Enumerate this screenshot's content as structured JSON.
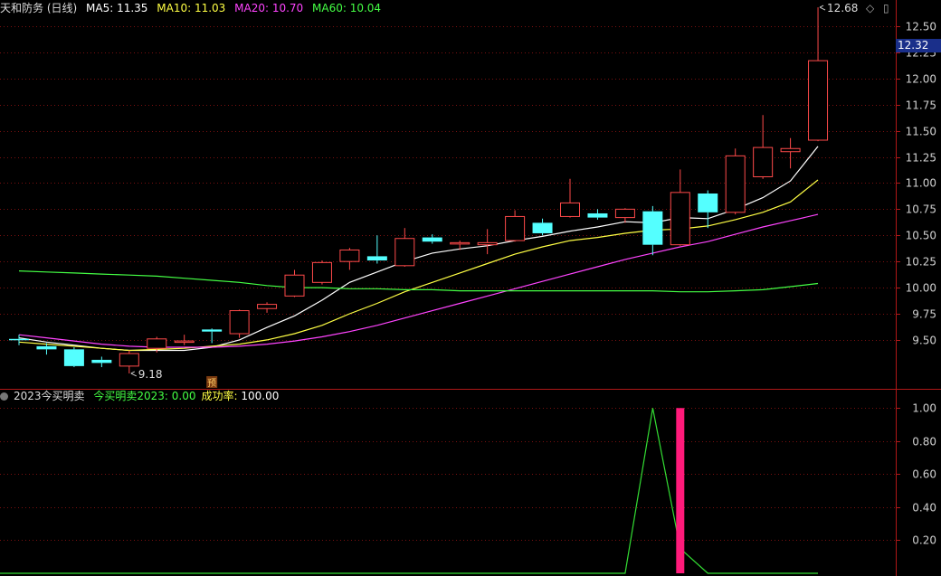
{
  "header": {
    "title": "天和防务 (日线)",
    "ma_items": [
      {
        "label": "MA5: 11.35",
        "color": "#ffffff"
      },
      {
        "label": "MA10: 11.03",
        "color": "#ffff44"
      },
      {
        "label": "MA20: 10.70",
        "color": "#ff44ff"
      },
      {
        "label": "MA60: 10.04",
        "color": "#44ff44"
      }
    ]
  },
  "current_price": "12.32",
  "marker_label": "预",
  "indicator": {
    "name": "2023今买明卖",
    "items": [
      {
        "label": "今买明卖2023: 0.00",
        "color": "#44ff44"
      },
      {
        "label": "成功率: ",
        "color": "#ffff44"
      },
      {
        "label": "100.00",
        "color": "#ffffff"
      }
    ]
  },
  "colors": {
    "up": "#ff4a4a",
    "down": "#54ffff",
    "axis": "#b01818",
    "grid": "#7a1010",
    "tick": "#d0d0d0",
    "signal_bar": "#ff1a7a"
  },
  "chart_data": [
    {
      "type": "candlestick",
      "ylim": [
        9.05,
        12.75
      ],
      "yticks": [
        9.5,
        9.75,
        10.0,
        10.25,
        10.5,
        10.75,
        11.0,
        11.25,
        11.5,
        11.75,
        12.0,
        12.25,
        12.5
      ],
      "ytick_labels": [
        "9.50",
        "9.75",
        "10.00",
        "10.25",
        "10.50",
        "10.75",
        "11.00",
        "11.25",
        "11.50",
        "11.75",
        "12.00",
        "12.25",
        "12.50"
      ],
      "annotations": [
        {
          "label": "12.68",
          "candle_index": 29,
          "value": 12.68
        },
        {
          "label": "9.18",
          "candle_index": 4,
          "value": 9.18
        }
      ],
      "candles": [
        {
          "o": 9.51,
          "h": 9.55,
          "l": 9.45,
          "c": 9.5
        },
        {
          "o": 9.44,
          "h": 9.47,
          "l": 9.36,
          "c": 9.41
        },
        {
          "o": 9.41,
          "h": 9.43,
          "l": 9.24,
          "c": 9.25
        },
        {
          "o": 9.31,
          "h": 9.34,
          "l": 9.24,
          "c": 9.28
        },
        {
          "o": 9.25,
          "h": 9.4,
          "l": 9.18,
          "c": 9.37
        },
        {
          "o": 9.42,
          "h": 9.53,
          "l": 9.38,
          "c": 9.51
        },
        {
          "o": 9.48,
          "h": 9.55,
          "l": 9.45,
          "c": 9.49
        },
        {
          "o": 9.6,
          "h": 9.61,
          "l": 9.47,
          "c": 9.58
        },
        {
          "o": 9.56,
          "h": 9.79,
          "l": 9.52,
          "c": 9.78
        },
        {
          "o": 9.8,
          "h": 9.86,
          "l": 9.76,
          "c": 9.84
        },
        {
          "o": 9.92,
          "h": 10.17,
          "l": 9.91,
          "c": 10.12
        },
        {
          "o": 10.05,
          "h": 10.26,
          "l": 10.03,
          "c": 10.24
        },
        {
          "o": 10.25,
          "h": 10.38,
          "l": 10.17,
          "c": 10.36
        },
        {
          "o": 10.3,
          "h": 10.5,
          "l": 10.23,
          "c": 10.26
        },
        {
          "o": 10.21,
          "h": 10.57,
          "l": 10.2,
          "c": 10.47
        },
        {
          "o": 10.48,
          "h": 10.51,
          "l": 10.42,
          "c": 10.44
        },
        {
          "o": 10.42,
          "h": 10.45,
          "l": 10.36,
          "c": 10.43
        },
        {
          "o": 10.41,
          "h": 10.56,
          "l": 10.32,
          "c": 10.43
        },
        {
          "o": 10.45,
          "h": 10.74,
          "l": 10.44,
          "c": 10.68
        },
        {
          "o": 10.62,
          "h": 10.66,
          "l": 10.5,
          "c": 10.52
        },
        {
          "o": 10.68,
          "h": 11.04,
          "l": 10.67,
          "c": 10.81
        },
        {
          "o": 10.71,
          "h": 10.75,
          "l": 10.65,
          "c": 10.67
        },
        {
          "o": 10.67,
          "h": 10.76,
          "l": 10.62,
          "c": 10.75
        },
        {
          "o": 10.73,
          "h": 10.78,
          "l": 10.31,
          "c": 10.41
        },
        {
          "o": 10.41,
          "h": 11.13,
          "l": 10.4,
          "c": 10.91
        },
        {
          "o": 10.9,
          "h": 10.93,
          "l": 10.57,
          "c": 10.72
        },
        {
          "o": 10.72,
          "h": 11.33,
          "l": 10.7,
          "c": 11.26
        },
        {
          "o": 11.06,
          "h": 11.65,
          "l": 11.04,
          "c": 11.34
        },
        {
          "o": 11.3,
          "h": 11.43,
          "l": 11.14,
          "c": 11.33
        },
        {
          "o": 11.41,
          "h": 12.68,
          "l": 11.4,
          "c": 12.17
        }
      ],
      "ma": [
        {
          "name": "MA5",
          "color": "#ffffff",
          "values": [
            9.52,
            9.48,
            9.45,
            9.42,
            9.4,
            9.4,
            9.4,
            9.43,
            9.5,
            9.62,
            9.73,
            9.88,
            10.05,
            10.15,
            10.25,
            10.33,
            10.37,
            10.4,
            10.45,
            10.49,
            10.54,
            10.58,
            10.63,
            10.62,
            10.67,
            10.66,
            10.75,
            10.86,
            11.02,
            11.35
          ]
        },
        {
          "name": "MA10",
          "color": "#ffff44",
          "values": [
            9.48,
            9.46,
            9.44,
            9.42,
            9.4,
            9.41,
            9.42,
            9.44,
            9.46,
            9.5,
            9.56,
            9.64,
            9.75,
            9.85,
            9.96,
            10.05,
            10.14,
            10.23,
            10.32,
            10.39,
            10.45,
            10.48,
            10.52,
            10.55,
            10.56,
            10.59,
            10.65,
            10.72,
            10.82,
            11.03
          ]
        },
        {
          "name": "MA20",
          "color": "#ff44ff",
          "values": [
            9.55,
            9.52,
            9.49,
            9.46,
            9.44,
            9.43,
            9.43,
            9.43,
            9.44,
            9.46,
            9.49,
            9.53,
            9.58,
            9.64,
            9.71,
            9.78,
            9.85,
            9.92,
            9.99,
            10.06,
            10.13,
            10.2,
            10.27,
            10.33,
            10.39,
            10.44,
            10.51,
            10.58,
            10.64,
            10.7
          ]
        },
        {
          "name": "MA60",
          "color": "#44ff44",
          "values": [
            10.16,
            10.15,
            10.14,
            10.13,
            10.12,
            10.11,
            10.09,
            10.07,
            10.05,
            10.02,
            10.0,
            10.0,
            9.99,
            9.99,
            9.98,
            9.98,
            9.97,
            9.97,
            9.97,
            9.97,
            9.97,
            9.97,
            9.97,
            9.97,
            9.96,
            9.96,
            9.97,
            9.98,
            10.01,
            10.04
          ]
        }
      ]
    },
    {
      "type": "line",
      "name": "今买明卖2023",
      "ylim": [
        0.0,
        1.1
      ],
      "yticks": [
        0.2,
        0.4,
        0.6,
        0.8,
        1.0
      ],
      "ytick_labels": [
        "0.20",
        "0.40",
        "0.60",
        "0.80",
        "1.00"
      ],
      "values": [
        0,
        0,
        0,
        0,
        0,
        0,
        0,
        0,
        0,
        0,
        0,
        0,
        0,
        0,
        0,
        0,
        0,
        0,
        0,
        0,
        0,
        0,
        0,
        1.0,
        0.15,
        0,
        0,
        0,
        0,
        0
      ],
      "bars": [
        {
          "index": 24,
          "value": 1.0
        }
      ]
    }
  ]
}
